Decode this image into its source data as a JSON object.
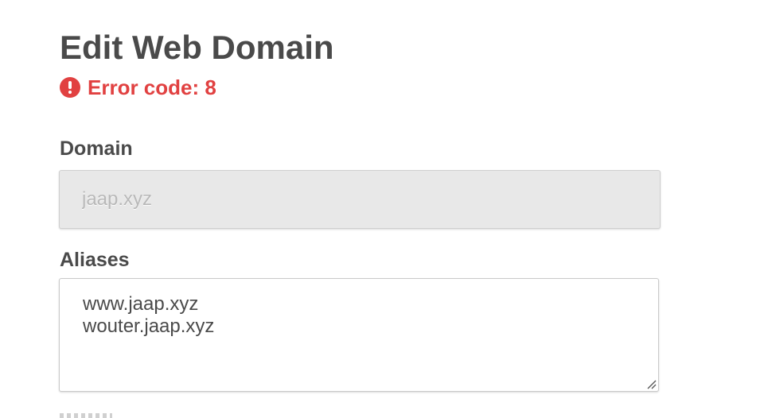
{
  "page": {
    "title": "Edit Web Domain"
  },
  "error": {
    "icon": "exclamation-circle-icon",
    "message": "Error code: 8",
    "color": "#e14141"
  },
  "form": {
    "domain": {
      "label": "Domain",
      "value": "jaap.xyz",
      "disabled": true
    },
    "aliases": {
      "label": "Aliases",
      "lines": [
        "www.jaap.xyz",
        "wouter.jaap.xyz"
      ]
    }
  }
}
